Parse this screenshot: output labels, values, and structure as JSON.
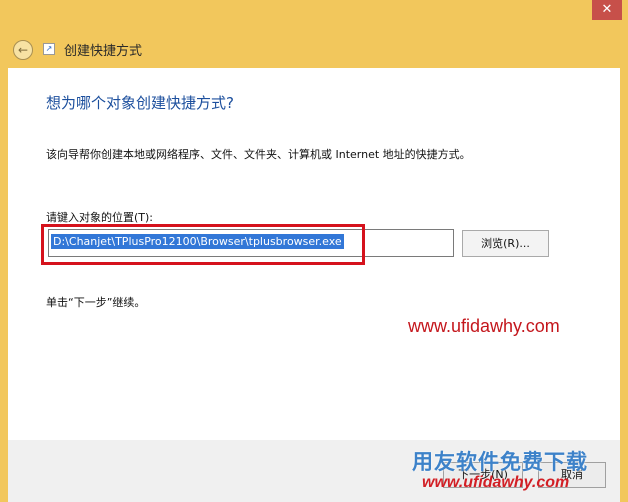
{
  "window": {
    "close_symbol": "✕"
  },
  "titlebar": {
    "back_symbol": "←",
    "title": "创建快捷方式"
  },
  "content": {
    "question": "想为哪个对象创建快捷方式?",
    "description": "该向导帮你创建本地或网络程序、文件、文件夹、计算机或 Internet 地址的快捷方式。",
    "location_label": "请键入对象的位置(T):",
    "location_value": "D:\\Chanjet\\TPlusPro12100\\Browser\\tplusbrowser.exe",
    "browse_label": "浏览(R)...",
    "continue_hint": "单击“下一步”继续。",
    "watermark_url": "www.ufidawhy.com"
  },
  "footer": {
    "next_label": "下一步(N)",
    "cancel_label": "取消"
  },
  "overlay": {
    "watermark_text": "用友软件免费下载",
    "watermark_url": "www.ufidawhy.com"
  },
  "colors": {
    "accent": "#1c4f9d",
    "highlight": "#3277d7",
    "annotation": "#d5121c",
    "frame": "#f2c75c"
  },
  "icons": [
    "close-icon",
    "back-arrow-icon",
    "shortcut-icon"
  ]
}
